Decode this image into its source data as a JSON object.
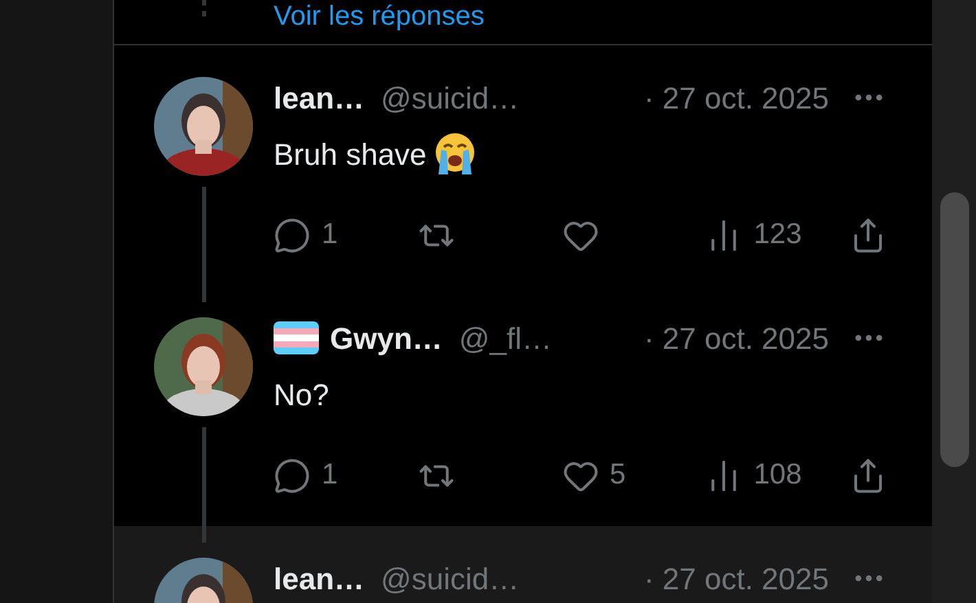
{
  "thread_top": {
    "link": "Voir les réponses"
  },
  "tweets": [
    {
      "name": "lean…",
      "handle": "@suicid…",
      "date": "· 27 oct. 2025",
      "text": "Bruh shave",
      "flag_badge": false,
      "crying_emoji": true,
      "thread_above": false,
      "thread_below": true,
      "highlighted": false,
      "show_actions": true,
      "replies": "1",
      "views": "123"
    },
    {
      "name": "Gwyn…",
      "handle": "@_fl…",
      "date": "· 27 oct. 2025",
      "text": "No?",
      "flag_badge": true,
      "crying_emoji": false,
      "thread_above": true,
      "thread_below": true,
      "highlighted": false,
      "show_actions": true,
      "replies": "1",
      "likes": "5",
      "views": "108"
    },
    {
      "name": "lean…",
      "handle": "@suicid…",
      "date": "· 27 oct. 2025",
      "flag_badge": false,
      "thread_above": true,
      "thread_below": false,
      "highlighted": true,
      "show_actions": false
    }
  ]
}
